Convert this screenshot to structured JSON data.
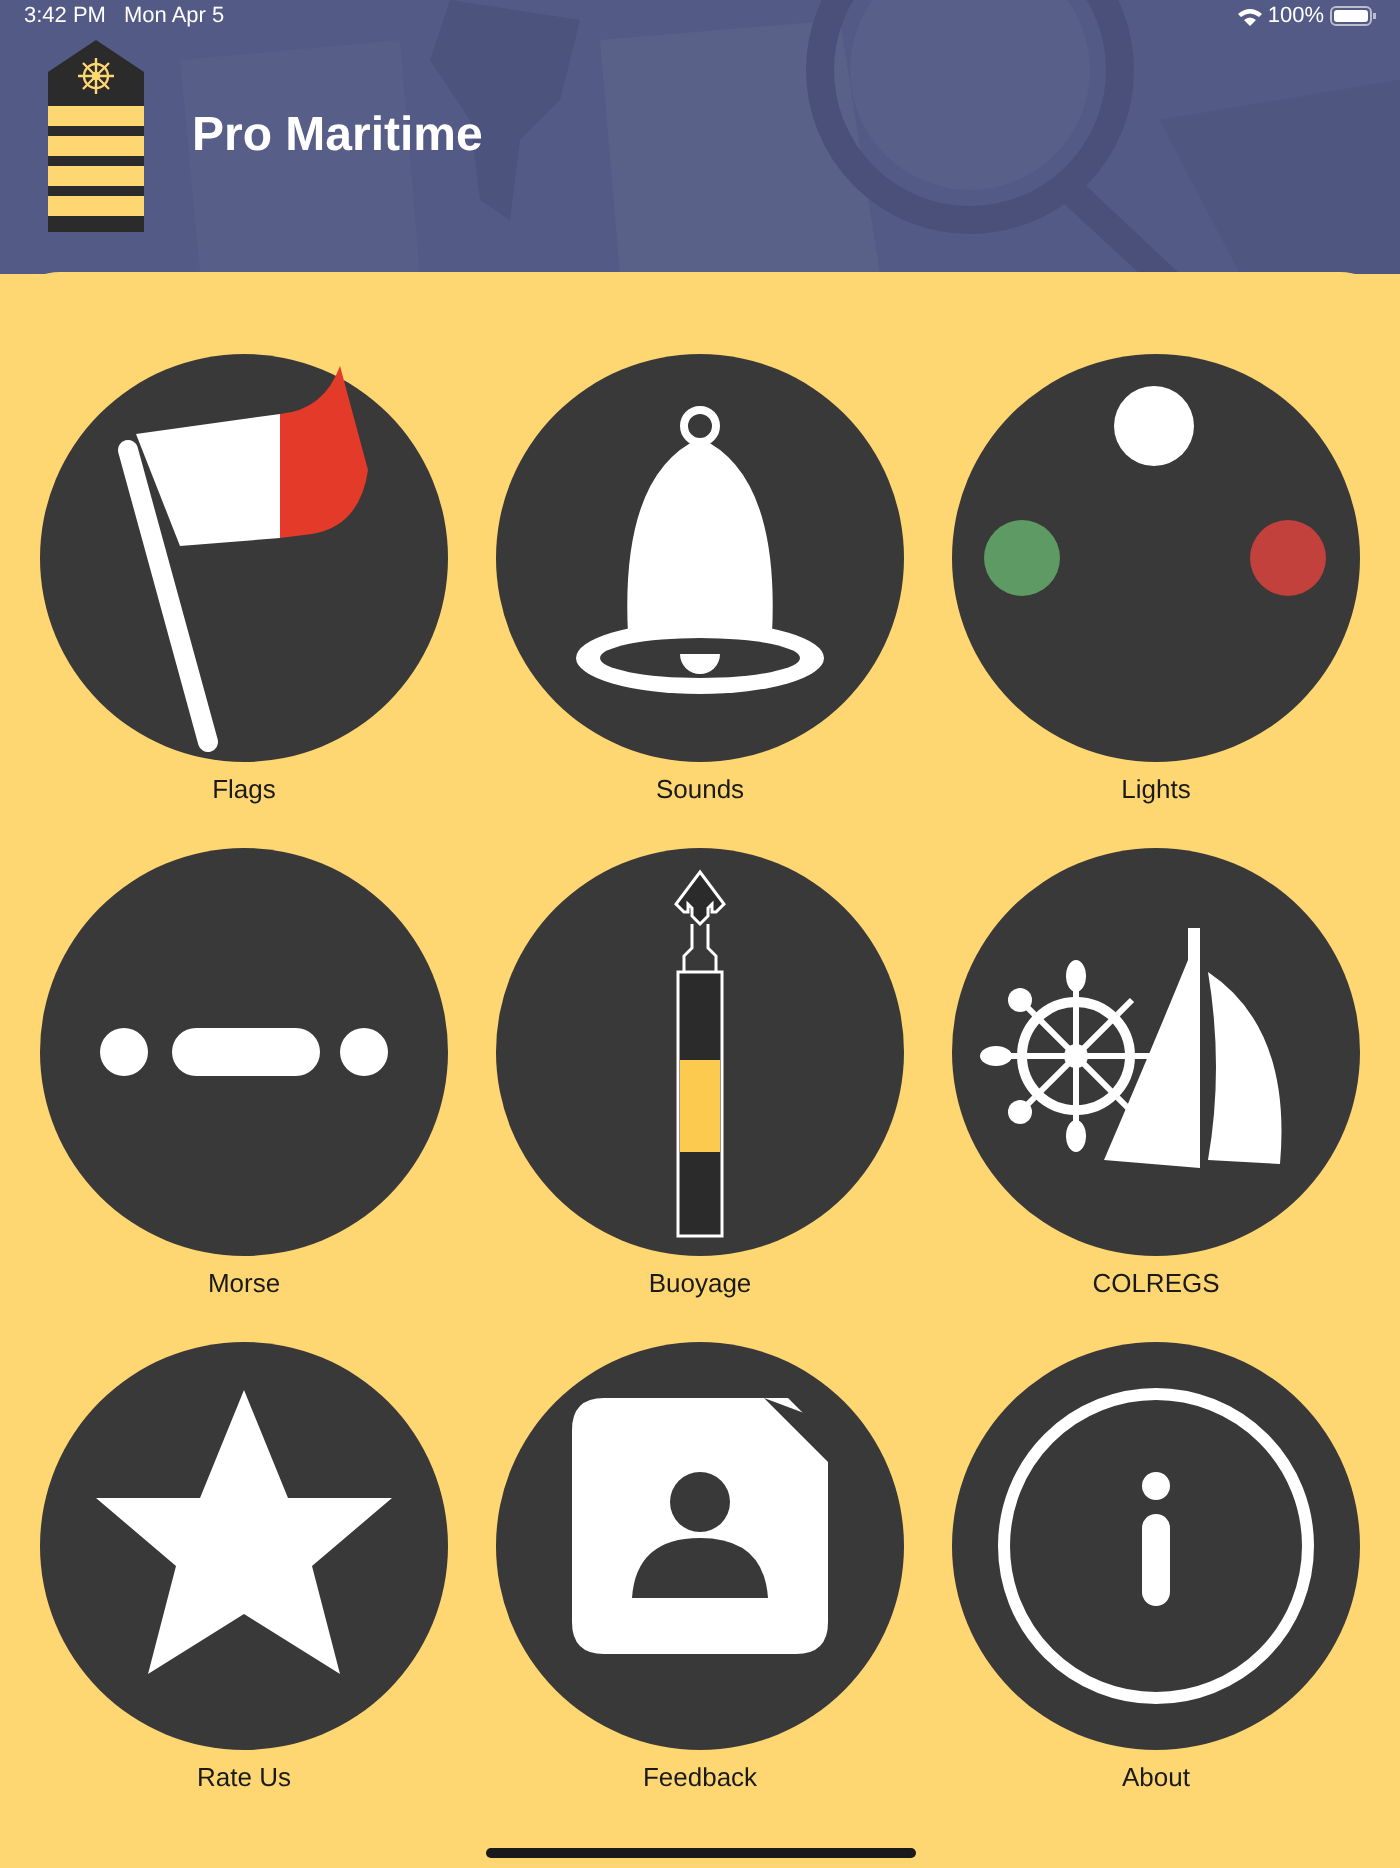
{
  "status_bar": {
    "time": "3:42 PM",
    "date": "Mon Apr 5",
    "battery": "100%"
  },
  "header": {
    "title": "Pro Maritime"
  },
  "tiles": [
    {
      "label": "Flags",
      "kind": "flag"
    },
    {
      "label": "Sounds",
      "kind": "bell"
    },
    {
      "label": "Lights",
      "kind": "lights"
    },
    {
      "label": "Morse",
      "kind": "morse"
    },
    {
      "label": "Buoyage",
      "kind": "buoy"
    },
    {
      "label": "COLREGS",
      "kind": "colregs"
    },
    {
      "label": "Rate Us",
      "kind": "star"
    },
    {
      "label": "Feedback",
      "kind": "feedback"
    },
    {
      "label": "About",
      "kind": "info"
    }
  ]
}
